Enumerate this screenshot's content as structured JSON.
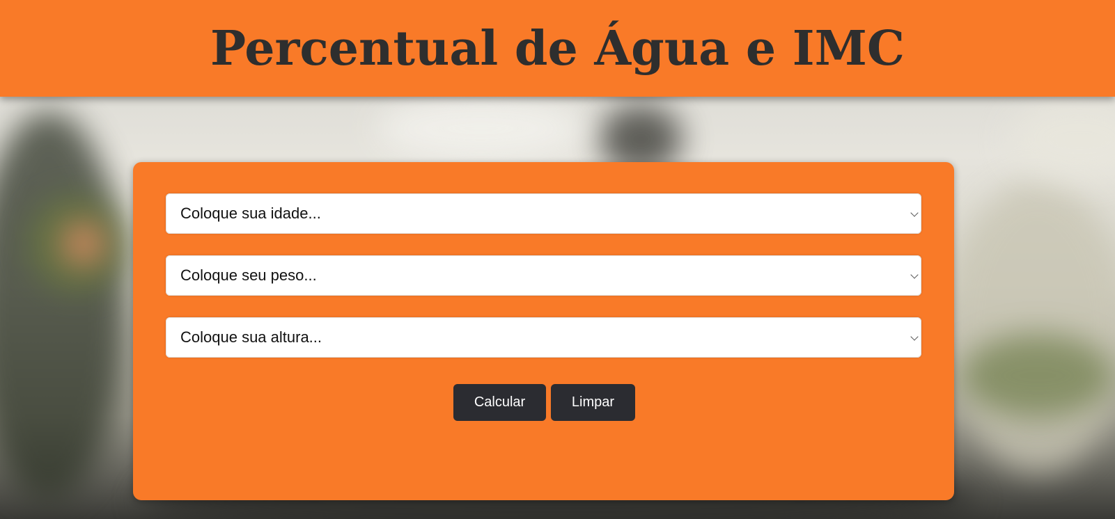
{
  "header": {
    "title": "Percentual de Água e IMC"
  },
  "form": {
    "age_select": {
      "placeholder": "Coloque sua idade..."
    },
    "weight_select": {
      "placeholder": "Coloque seu peso..."
    },
    "height_select": {
      "placeholder": "Coloque sua altura..."
    },
    "calculate_label": "Calcular",
    "clear_label": "Limpar"
  },
  "colors": {
    "accent": "#f97a28",
    "button": "#2b2c31",
    "title_text": "#2e2e2e"
  },
  "icons": {
    "select_indicator": "chevron-down-icon"
  }
}
